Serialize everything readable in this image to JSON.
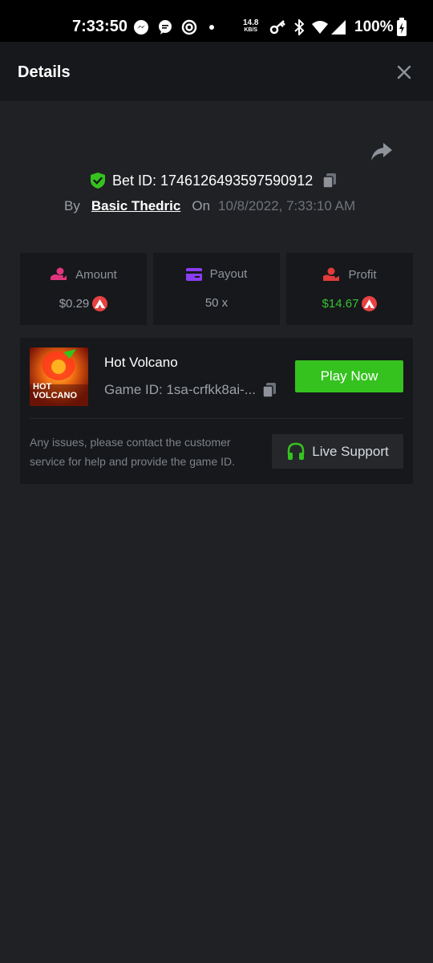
{
  "status_bar": {
    "time": "7:33:50",
    "net_speed": "14.8",
    "net_speed_unit": "KB/S",
    "battery": "100%",
    "icons": [
      "messenger-icon",
      "chat-icon",
      "app-icon",
      "dot-icon",
      "key-icon",
      "bluetooth-icon",
      "wifi-icon",
      "signal-icon",
      "battery-charging-icon"
    ]
  },
  "header": {
    "title": "Details",
    "close_icon": "close-icon"
  },
  "bet": {
    "id_label": "Bet ID: 1746126493597590912",
    "by_label": "By",
    "user": "Basic Thedric",
    "on_label": "On",
    "date": "10/8/2022, 7:33:10 AM"
  },
  "stats": {
    "amount": {
      "label": "Amount",
      "value": "$0.29"
    },
    "payout": {
      "label": "Payout",
      "value": "50 x"
    },
    "profit": {
      "label": "Profit",
      "value": "$14.67"
    }
  },
  "game": {
    "title": "Hot Volcano",
    "id_label": "Game ID: 1sa-crfkk8ai-...",
    "thumb_text_line1": "HOT",
    "thumb_text_line2": "VOLCANO",
    "play_label": "Play Now",
    "help_text": "Any issues, please contact the customer service for help and provide the game ID.",
    "support_label": "Live Support"
  },
  "colors": {
    "background": "#202124",
    "card": "#17181b",
    "accent_green": "#35c21f",
    "profit_green": "#35c232",
    "coin_red": "#e84142"
  }
}
